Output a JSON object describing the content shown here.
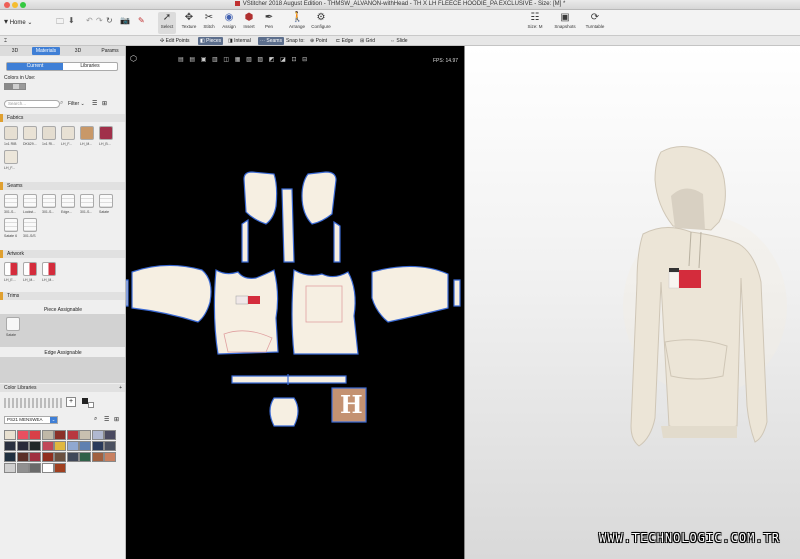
{
  "window": {
    "title": "VStitcher 2018 August Edition - THMSW_ALVANON-withHead - TH X LH FLEECE HOODIE_PA EXCLUSIVE - Size: [M] *"
  },
  "toolbar": {
    "home_label": "Home",
    "tools": [
      {
        "label": "Select",
        "icon": "arrow-icon"
      },
      {
        "label": "Texture",
        "icon": "texture-icon"
      },
      {
        "label": "Stitch",
        "icon": "stitch-icon"
      },
      {
        "label": "Assign",
        "icon": "assign-icon"
      },
      {
        "label": "Insert",
        "icon": "insert-icon"
      },
      {
        "label": "Pen",
        "icon": "pen-icon"
      },
      {
        "label": "Arrange",
        "icon": "arrange-icon"
      },
      {
        "label": "Configure",
        "icon": "configure-icon"
      }
    ],
    "right_tools": [
      {
        "label": "Size: M",
        "icon": "size-icon"
      },
      {
        "label": "Snapshots",
        "icon": "camera-icon"
      },
      {
        "label": "Turntable",
        "icon": "turntable-icon"
      }
    ]
  },
  "subbar": {
    "items": [
      "Edit Points",
      "Pieces",
      "Internal",
      "Seams",
      "Snap to:",
      "Point",
      "Edge",
      "Grid",
      "Slide"
    ],
    "active": [
      "Pieces",
      "Seams"
    ]
  },
  "left_panel": {
    "tabs": [
      "3D",
      "Materials",
      "3D",
      "Params"
    ],
    "active_tab": "Materials",
    "subtabs": [
      "Current",
      "Libraries"
    ],
    "colors_in_use_label": "Colors in Use:",
    "search_placeholder": "Search...",
    "filter_label": "Filter",
    "fabrics": {
      "title": "Fabrics",
      "items": [
        "1x1 RIB",
        "DK629...",
        "1x1 RI...",
        "LH_F...",
        "LH_M...",
        "LH_B...",
        "LH_F..."
      ],
      "colors": [
        "#e6dfd2",
        "#e9e2d5",
        "#e4ddd0",
        "#e8e1d4",
        "#c89868",
        "#a0304a",
        "#ece6da"
      ]
    },
    "seams": {
      "title": "Seams",
      "items": [
        "301-S...",
        "Lockst...",
        "301-S...",
        "Edge...",
        "301-S...",
        "Satate",
        "Satate 6",
        "301-S/S"
      ]
    },
    "artwork": {
      "title": "Artwork",
      "items": [
        "LH_E...",
        "LH_M...",
        "LH_M..."
      ]
    },
    "trims": {
      "title": "Trims"
    },
    "piece_assignable": {
      "title": "Piece Assignable",
      "items": [
        "Satate"
      ]
    },
    "edge_assignable": {
      "title": "Edge Assignable"
    },
    "color_libraries": {
      "title": "Color Libraries",
      "library_name": "PS21 MENSWEA",
      "swatches": [
        "#e8e0d0",
        "#e85060",
        "#d84048",
        "#c0b8a8",
        "#8a3028",
        "#b83840",
        "#c8c0b0",
        "#b0b8d0",
        "#4a4a60",
        "#2a3040",
        "#2a2a3a",
        "#202828",
        "#c04858",
        "#e0b840",
        "#90a8d0",
        "#6080b0",
        "#2a3a5a",
        "#4a5060",
        "#203040",
        "#5a3028",
        "#a03040",
        "#903020",
        "#6a5040",
        "#404858",
        "#306048",
        "#a06040",
        "#c88060",
        "#d0d0d0",
        "#909090",
        "#6a6a6a",
        "#ffffff",
        "#a04020"
      ]
    }
  },
  "viewport2d": {
    "fps_label": "FPS: 14.97",
    "logo_letter": "H"
  },
  "watermark": "WWW.TECHNOLOGIC.COM.TR",
  "colors": {
    "fabric": "#f6efe2",
    "piece_outline": "#3b6ad4",
    "accent_red": "#d42c3c",
    "logo_tan": "#c49272"
  }
}
